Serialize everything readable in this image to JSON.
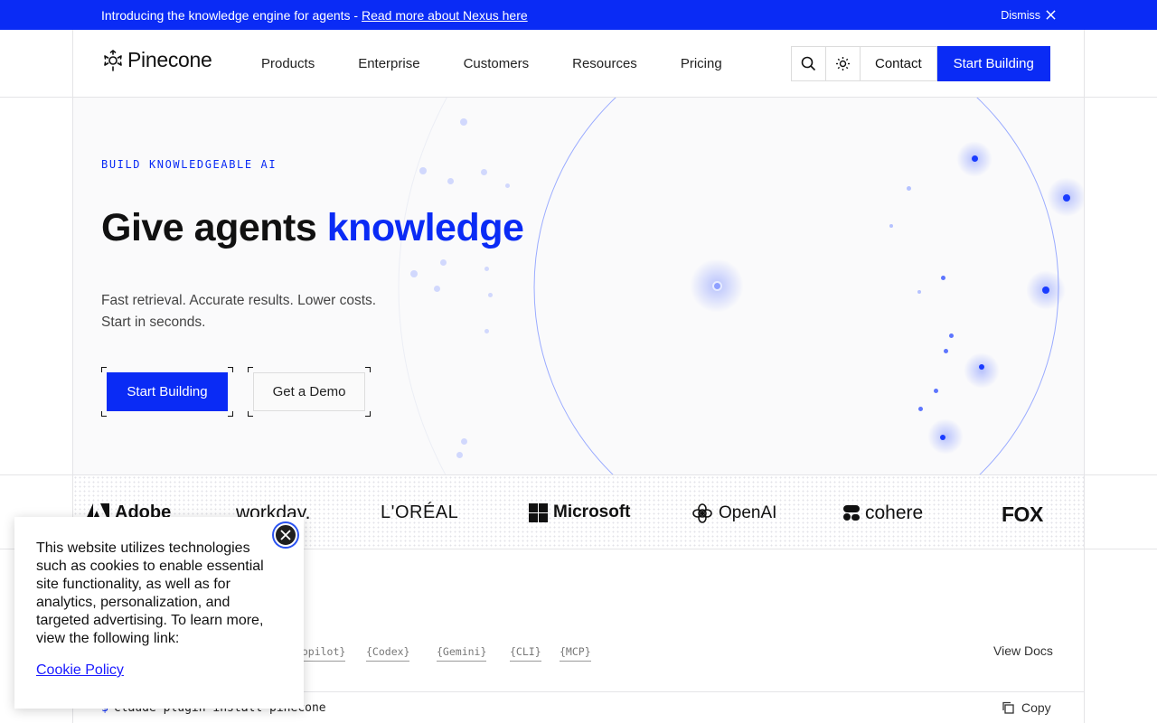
{
  "announcement": {
    "text": "Introducing the knowledge engine for agents - ",
    "link": "Read more about Nexus here",
    "dismiss": "Dismiss"
  },
  "header": {
    "logo": "Pinecone",
    "nav": [
      "Products",
      "Enterprise",
      "Customers",
      "Resources",
      "Pricing"
    ],
    "contact": "Contact",
    "cta": "Start Building"
  },
  "hero": {
    "eyebrow": "BUILD KNOWLEDGEABLE AI",
    "headline_plain": "Give agents ",
    "headline_accent": "knowledge",
    "sub_line1": "Fast retrieval. Accurate results. Lower costs.",
    "sub_line2": "Start in seconds.",
    "primary_button": "Start Building",
    "secondary_button": "Get a Demo"
  },
  "logos": [
    "Adobe",
    "workday.",
    "L'ORÉAL",
    "Microsoft",
    "OpenAI",
    "cohere",
    "FOX"
  ],
  "integrations": {
    "tags": [
      "{Copilot}",
      "{Codex}",
      "{Gemini}",
      "{CLI}",
      "{MCP}"
    ],
    "view_docs": "View Docs",
    "command_prompt": "$",
    "command": "claude plugin install pinecone",
    "copy": "Copy"
  },
  "cookie": {
    "text": "This website utilizes technologies such as cookies to enable essential site functionality, as well as for analytics, personalization, and targeted advertising. To learn more, view the following link:",
    "link": "Cookie Policy"
  },
  "colors": {
    "brand_blue": "#0a2bf5",
    "banner_bg": "#0a2bf5"
  }
}
